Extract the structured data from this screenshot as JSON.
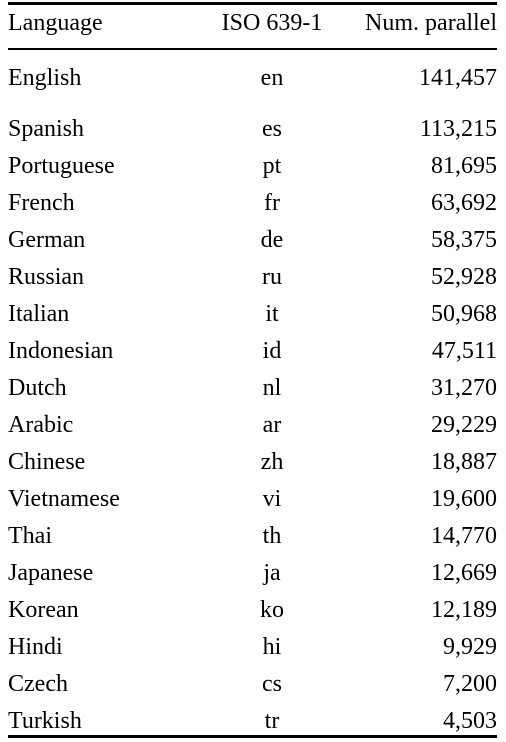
{
  "table": {
    "columns": [
      {
        "key": "language",
        "label": "Language",
        "align": "left"
      },
      {
        "key": "code",
        "label": "ISO 639-1",
        "align": "center"
      },
      {
        "key": "num_parallel",
        "label": "Num. parallel",
        "align": "right"
      }
    ],
    "rows": [
      {
        "language": "English",
        "code": "en",
        "num_parallel": "141,457"
      },
      {
        "language": "Spanish",
        "code": "es",
        "num_parallel": "113,215"
      },
      {
        "language": "Portuguese",
        "code": "pt",
        "num_parallel": "81,695"
      },
      {
        "language": "French",
        "code": "fr",
        "num_parallel": "63,692"
      },
      {
        "language": "German",
        "code": "de",
        "num_parallel": "58,375"
      },
      {
        "language": "Russian",
        "code": "ru",
        "num_parallel": "52,928"
      },
      {
        "language": "Italian",
        "code": "it",
        "num_parallel": "50,968"
      },
      {
        "language": "Indonesian",
        "code": "id",
        "num_parallel": "47,511"
      },
      {
        "language": "Dutch",
        "code": "nl",
        "num_parallel": "31,270"
      },
      {
        "language": "Arabic",
        "code": "ar",
        "num_parallel": "29,229"
      },
      {
        "language": "Chinese",
        "code": "zh",
        "num_parallel": "18,887"
      },
      {
        "language": "Vietnamese",
        "code": "vi",
        "num_parallel": "19,600"
      },
      {
        "language": "Thai",
        "code": "th",
        "num_parallel": "14,770"
      },
      {
        "language": "Japanese",
        "code": "ja",
        "num_parallel": "12,669"
      },
      {
        "language": "Korean",
        "code": "ko",
        "num_parallel": "12,189"
      },
      {
        "language": "Hindi",
        "code": "hi",
        "num_parallel": "9,929"
      },
      {
        "language": "Czech",
        "code": "cs",
        "num_parallel": "7,200"
      },
      {
        "language": "Turkish",
        "code": "tr",
        "num_parallel": "4,503"
      }
    ]
  },
  "chart_data": {
    "type": "table",
    "title": "",
    "columns": [
      "Language",
      "ISO 639-1",
      "Num. parallel"
    ],
    "categories": [
      "English",
      "Spanish",
      "Portuguese",
      "French",
      "German",
      "Russian",
      "Italian",
      "Indonesian",
      "Dutch",
      "Arabic",
      "Chinese",
      "Vietnamese",
      "Thai",
      "Japanese",
      "Korean",
      "Hindi",
      "Czech",
      "Turkish"
    ],
    "codes": [
      "en",
      "es",
      "pt",
      "fr",
      "de",
      "ru",
      "it",
      "id",
      "nl",
      "ar",
      "zh",
      "vi",
      "th",
      "ja",
      "ko",
      "hi",
      "cs",
      "tr"
    ],
    "values": [
      141457,
      113215,
      81695,
      63692,
      58375,
      52928,
      50968,
      47511,
      31270,
      29229,
      18887,
      19600,
      14770,
      12669,
      12189,
      9929,
      7200,
      4503
    ],
    "xlabel": "Language",
    "ylabel": "Num. parallel",
    "grid": false,
    "legend": "none"
  }
}
